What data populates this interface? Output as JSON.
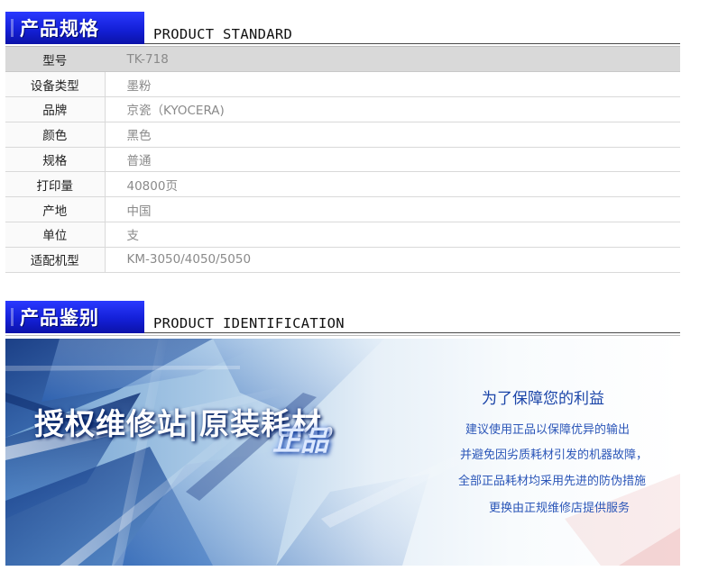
{
  "spec_section": {
    "title_cn": "产品规格",
    "title_en": "PRODUCT STANDARD",
    "rows": [
      {
        "label": "型号",
        "value": "TK-718"
      },
      {
        "label": "设备类型",
        "value": "墨粉"
      },
      {
        "label": "品牌",
        "value": "京瓷（KYOCERA)"
      },
      {
        "label": "颜色",
        "value": "黑色"
      },
      {
        "label": "规格",
        "value": "普通"
      },
      {
        "label": "打印量",
        "value": "40800页"
      },
      {
        "label": "产地",
        "value": "中国"
      },
      {
        "label": "单位",
        "value": "支"
      },
      {
        "label": "适配机型",
        "value": "KM-3050/4050/5050"
      }
    ]
  },
  "ident_section": {
    "title_cn": "产品鉴别",
    "title_en": "PRODUCT IDENTIFICATION"
  },
  "banner": {
    "title": "授权维修站|原装耗材，",
    "subtitle": "正品",
    "headline": "为了保障您的利益",
    "lines": [
      "建议使用正品以保障优异的输出",
      "并避免因劣质耗材引发的机器故障，",
      "全部正品耗材均采用先进的防伪措施",
      "更换由正规维修店提供服务"
    ]
  }
}
